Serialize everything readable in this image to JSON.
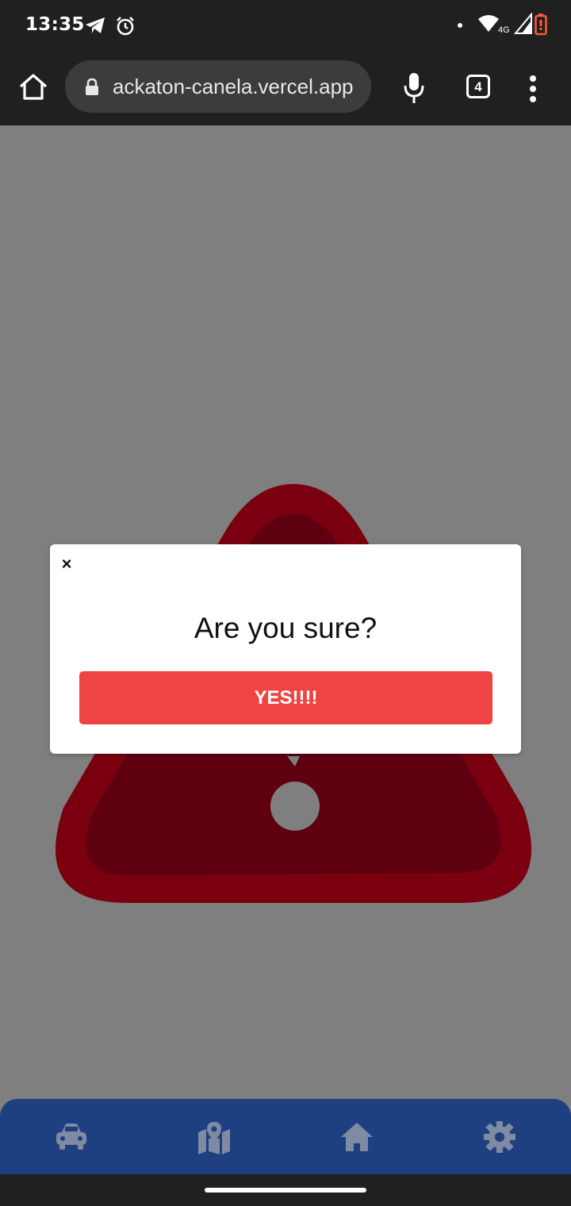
{
  "status_bar": {
    "time": "13:35",
    "icons": [
      "telegram-icon",
      "alarm-icon",
      "notification-dot-icon",
      "wifi-icon",
      "signal-4g-icon",
      "battery-icon"
    ],
    "network_label": "4G",
    "battery_color": "#ff5a36"
  },
  "browser": {
    "url": "ackaton-canela.vercel.app",
    "tab_count": "4",
    "icons": [
      "home-icon",
      "lock-icon",
      "mic-icon",
      "tabs-icon",
      "more-vert-icon"
    ]
  },
  "page": {
    "background": "#7f7f7f",
    "warning_colors": {
      "outer": "#7a0010",
      "inner": "#5e0010"
    }
  },
  "modal": {
    "close_label": "×",
    "title": "Are you sure?",
    "confirm_label": "YES!!!!",
    "confirm_color": "#ef4444"
  },
  "bottom_nav": {
    "color": "#1e3f80",
    "icon_color": "#7f8aa3",
    "items": [
      {
        "icon": "car-icon"
      },
      {
        "icon": "map-icon"
      },
      {
        "icon": "home-icon"
      },
      {
        "icon": "settings-gear-icon"
      }
    ]
  }
}
